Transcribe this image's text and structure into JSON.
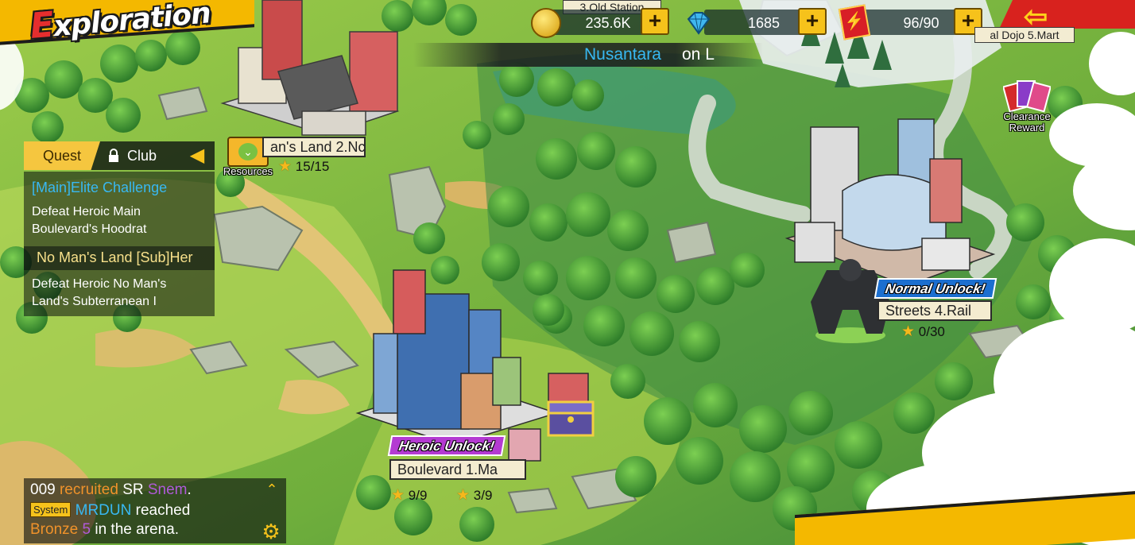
{
  "title": "Exploration",
  "top_bar": {
    "location_label": "3.Old Station",
    "coins": "235.6K",
    "gems": "1685",
    "stamina": "96/90",
    "plus_symbol": "+",
    "dojo_label": "al Dojo 5.Mart",
    "icons": [
      "coin-icon",
      "gem-icon",
      "stamina-ticket-icon",
      "back-arrow-icon"
    ]
  },
  "ticker": {
    "highlight": "Nusantara",
    "rest": "on L"
  },
  "quest_panel": {
    "tab_quest": "Quest",
    "tab_club": "Club",
    "quests": [
      {
        "title": "[Main]Elite Challenge",
        "desc": "Defeat Heroic Main Boulevard's Hoodrat"
      },
      {
        "title": "No Man's Land  [Sub]Her",
        "desc": "Defeat Heroic No Man's Land's Subterranean I"
      }
    ]
  },
  "resources_button": {
    "label": "Resources"
  },
  "stages": [
    {
      "name": "an's Land 2.Nc",
      "stars": "15/15"
    },
    {
      "badge": "Heroic Unlock!",
      "name": "Boulevard 1.Ma",
      "stars_a": "9/9",
      "stars_b": "3/9"
    },
    {
      "badge": "Normal Unlock!",
      "name": "Streets 4.Rail",
      "stars": "0/30"
    }
  ],
  "clearance_reward": {
    "line1": "Clearance",
    "line2": "Reward"
  },
  "chat": {
    "line1_a": "009",
    "line1_b": "recruited",
    "line1_c": "SR",
    "line1_d": "Snem",
    "line1_e": ".",
    "line2_badge": "System",
    "line2_name": "MRDUN",
    "line2_text": "reached",
    "line3_a": "Bronze",
    "line3_b": "5",
    "line3_c": "in the arena."
  },
  "colors": {
    "accent_yellow": "#f6c21b",
    "quest_blue": "#38b8f2",
    "heroic_purple": "#b43ad2",
    "normal_blue": "#1c6fd0",
    "brand_red": "#d8221e"
  }
}
